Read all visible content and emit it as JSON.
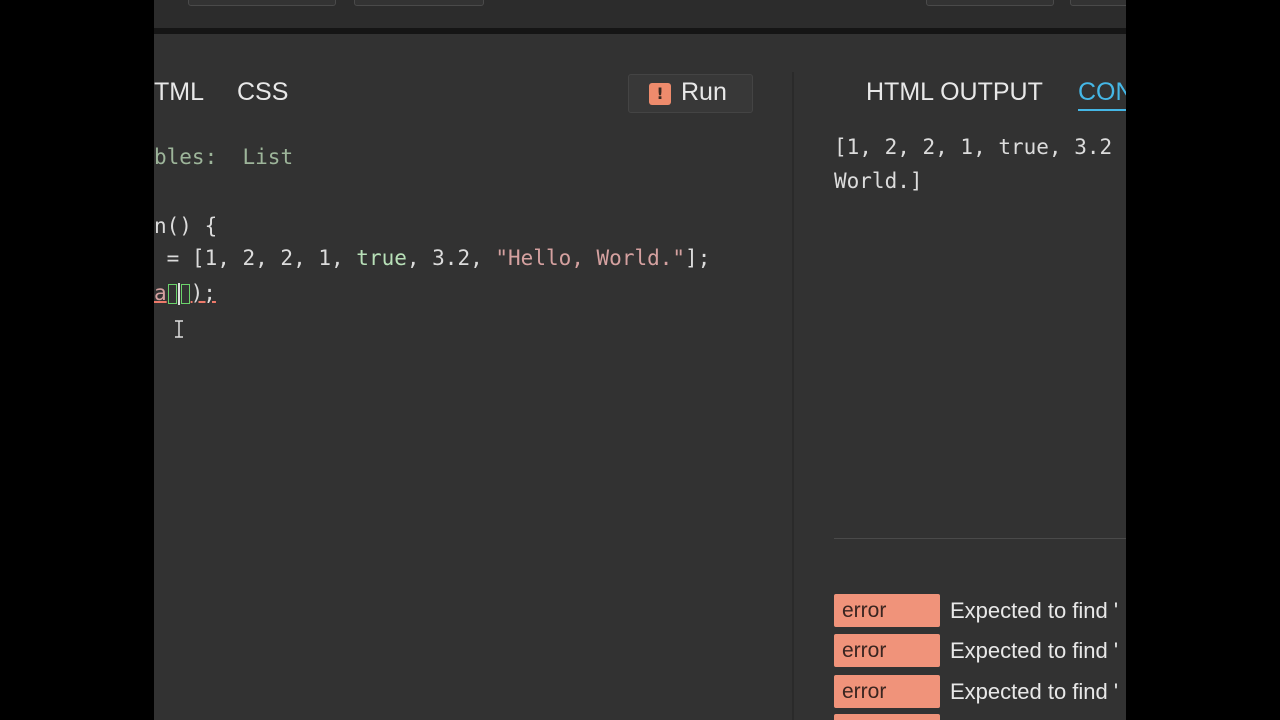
{
  "editor": {
    "tabs": [
      "TML",
      "CSS"
    ],
    "run_label": "Run",
    "run_icon": "warning-icon",
    "lines": {
      "comment_tail": "bles:",
      "comment_value": "List",
      "func_line": "n() {",
      "assign_prefix": " = [1, 2, 2, 1, ",
      "assign_true": "true",
      "assign_mid": ", 3.2, ",
      "assign_string": "\"Hello, World.\"",
      "assign_end": "];",
      "call_prefix": "a",
      "call_end": ");"
    }
  },
  "output_panel": {
    "tabs": [
      "HTML OUTPUT",
      "CON"
    ],
    "text": "[1, 2, 2, 1, true, 3.2\nWorld.]",
    "errors": [
      {
        "type": "error",
        "message": "Expected to find '"
      },
      {
        "type": "error",
        "message": "Expected to find '"
      },
      {
        "type": "error",
        "message": "Expected to find '"
      }
    ]
  },
  "colors": {
    "accent": "#45b7e6",
    "error_badge": "#f0937a",
    "background": "#323232"
  }
}
